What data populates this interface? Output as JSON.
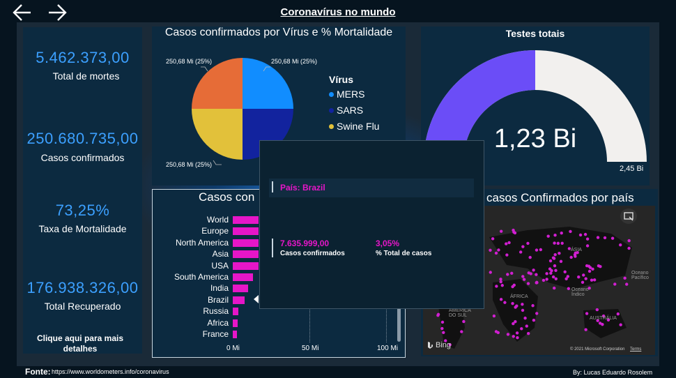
{
  "header": {
    "title": "Coronavírus no mundo",
    "back_icon": "arrow-left-icon",
    "forward_icon": "arrow-right-icon"
  },
  "kpis": [
    {
      "value": "5.462.373,00",
      "label": "Total de mortes"
    },
    {
      "value": "250.680.735,00",
      "label": "Casos confirmados"
    },
    {
      "value": "73,25%",
      "label": "Taxa de Mortalidade"
    },
    {
      "value": "176.938.326,00",
      "label": "Total Recuperado"
    }
  ],
  "details_link": "Clique aqui para mais detalhes",
  "pie_chart": {
    "title": "Casos confirmados por Vírus e % Mortalidade",
    "slice_label": "250,68 Mi (25%)",
    "legend_title": "Vírus",
    "legend": [
      {
        "name": "MERS",
        "color": "#118dff"
      },
      {
        "name": "SARS",
        "color": "#12239e"
      },
      {
        "name": "Swine Flu",
        "color": "#e2c13a"
      }
    ],
    "slice_colors": [
      "#118dff",
      "#12239e",
      "#e2c13a",
      "#e66c37"
    ]
  },
  "gauge": {
    "title": "Testes totais",
    "value": "1,23 Bi",
    "max": "2,45 Bi",
    "fill_fraction": 0.5,
    "fill_color": "#6b4df7",
    "track_color": "#f2f0ee"
  },
  "bar_chart": {
    "title": "Casos con",
    "ticks": [
      "0 Mi",
      "50 Mi",
      "100 Mi"
    ]
  },
  "chart_data": {
    "type": "bar",
    "orientation": "horizontal",
    "categories": [
      "World",
      "Europe",
      "North America",
      "Asia",
      "USA",
      "South America",
      "India",
      "Brazil",
      "Russia",
      "Africa",
      "France"
    ],
    "values": [
      17,
      17,
      17,
      17,
      17,
      13,
      10,
      7.6,
      3.5,
      3,
      2.5
    ],
    "xlim": [
      0,
      100
    ],
    "xlabel": "",
    "ylabel": "",
    "color": "#e616c8"
  },
  "map": {
    "title": "casos Confirmados por país",
    "labels": {
      "asia": "ÁSIA",
      "oceano1": "Oceano",
      "oceano2": "Índico",
      "oceano3": "Pacífico",
      "africa": "ÁFRICA",
      "am1": "AMÉRICA",
      "am2": "DO SUL",
      "aus": "AUSTRÁLIA"
    },
    "bing": "Bing",
    "copyright": "© 2021 Microsoft Corporation",
    "terms": "Terms",
    "focus_icon": "focus-mode-icon"
  },
  "tooltip": {
    "country": "País: Brazil",
    "cases_value": "7.635.999,00",
    "cases_label": "Casos confirmados",
    "pct_value": "3,05%",
    "pct_label": "% Total de casos"
  },
  "footer": {
    "fonte": "Fonte:",
    "url": "https://www.worldometers.info/coronavirus",
    "author": "By: Lucas Eduardo Rosolem"
  }
}
